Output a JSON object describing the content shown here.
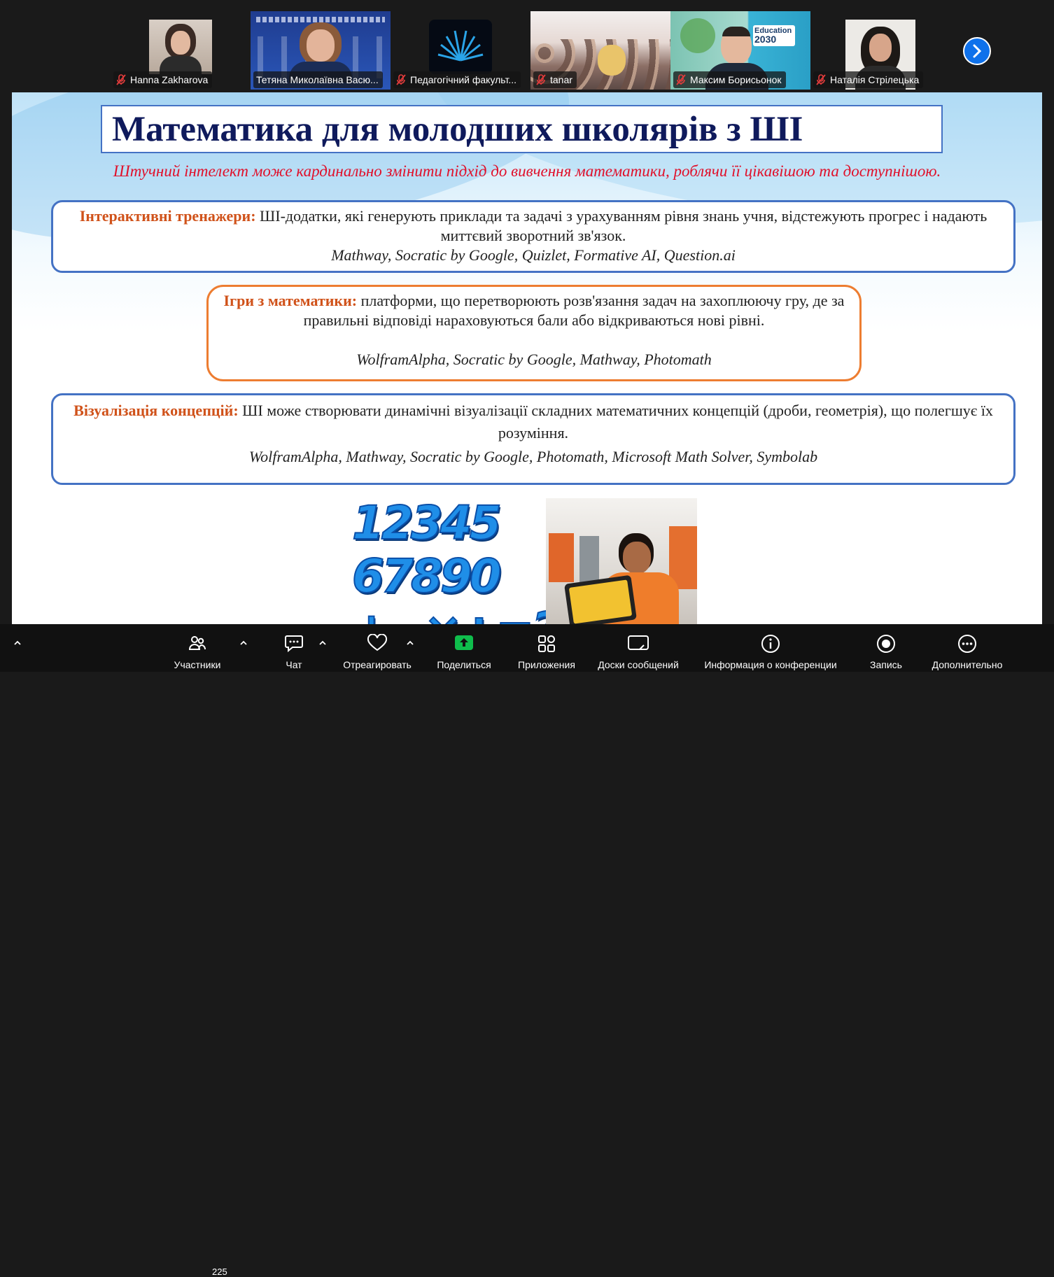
{
  "participants": [
    {
      "name": "Hanna Zakharova"
    },
    {
      "name": "Тетяна Миколаївна Васю..."
    },
    {
      "name": "Педагогічний факульт..."
    },
    {
      "name": "tanar"
    },
    {
      "name": "Максим Борисьонок"
    },
    {
      "name": "Наталія Стрілецька"
    }
  ],
  "slide": {
    "title": "Математика для молодших школярів з ШІ",
    "subtitle": "Штучний інтелект може кардинально змінити підхід до вивчення математики, роблячи її цікавішою та доступнішою.",
    "cards": [
      {
        "label": "Інтерактивні тренажери:",
        "text": " ШІ-додатки, які генерують приклади та задачі з урахуванням рівня знань учня, відстежують прогрес і надають миттєвий зворотний зв'язок.",
        "tools": "Mathway, Socratic by Google, Quizlet, Formative AI, Question.ai"
      },
      {
        "label": "Ігри з математики:",
        "text": " платформи, що перетворюють розв'язання задач на захоплюючу гру, де за правильні відповіді нараховуються бали або відкриваються нові рівні.",
        "tools": "WolframAlpha, Socratic by Google, Mathway, Photomath"
      },
      {
        "label": "Візуалізація концепцій:",
        "text": " ШІ може створювати динамічні візуалізації складних математичних концепцій (дроби, геометрія), що полегшує їх розуміння.",
        "tools": "WolframAlpha, Mathway, Socratic by Google, Photomath, Microsoft Math Solver, Symbolab"
      }
    ],
    "numbers_line1": "12345",
    "numbers_line2": "67890",
    "numbers_line3": "+−×÷=?"
  },
  "photo_text": {
    "edu_top": "Education",
    "edu_bottom": "2030"
  },
  "toolbar": {
    "participants_label": "Участники",
    "participants_count": "225",
    "chat_label": "Чат",
    "react_label": "Отреагировать",
    "share_label": "Поделиться",
    "apps_label": "Приложения",
    "boards_label": "Доски сообщений",
    "info_label": "Информация о конференции",
    "record_label": "Запись",
    "more_label": "Дополнительно"
  },
  "colors": {
    "accent_share": "#0fbd4c",
    "next_button": "#0e71eb",
    "title_text": "#0f1a5c",
    "subtitle_text": "#e0102a",
    "label_text": "#d0521a",
    "blue_border": "#4472c4",
    "orange_border": "#ed7d31"
  }
}
